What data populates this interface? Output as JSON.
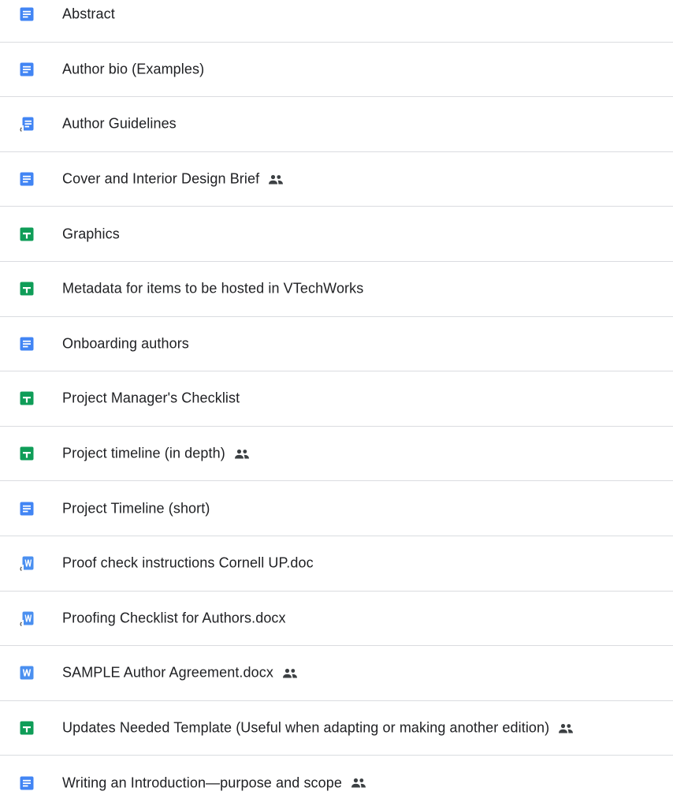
{
  "colors": {
    "docs_blue": "#4285f4",
    "sheets_green": "#0f9d58",
    "word_blue": "#4a8ff0",
    "shared_icon": "#3c4043",
    "divider": "#dadce0"
  },
  "files": [
    {
      "name": "Abstract",
      "icon": "google-docs-icon",
      "shared": false
    },
    {
      "name": "Author bio (Examples)",
      "icon": "google-docs-icon",
      "shared": false
    },
    {
      "name": "Author Guidelines",
      "icon": "google-docs-shortcut-icon",
      "shared": false
    },
    {
      "name": "Cover and Interior Design Brief",
      "icon": "google-docs-icon",
      "shared": true
    },
    {
      "name": "Graphics",
      "icon": "google-sheets-icon",
      "shared": false
    },
    {
      "name": "Metadata for items to be hosted in VTechWorks",
      "icon": "google-sheets-icon",
      "shared": false
    },
    {
      "name": "Onboarding authors",
      "icon": "google-docs-icon",
      "shared": false
    },
    {
      "name": "Project Manager's Checklist",
      "icon": "google-sheets-icon",
      "shared": false
    },
    {
      "name": "Project timeline (in depth)",
      "icon": "google-sheets-icon",
      "shared": true
    },
    {
      "name": "Project Timeline (short)",
      "icon": "google-docs-icon",
      "shared": false
    },
    {
      "name": "Proof check instructions Cornell UP.doc",
      "icon": "word-shortcut-icon",
      "shared": false
    },
    {
      "name": "Proofing Checklist for Authors.docx",
      "icon": "word-shortcut-icon",
      "shared": false
    },
    {
      "name": "SAMPLE Author Agreement.docx",
      "icon": "word-icon",
      "shared": true
    },
    {
      "name": "Updates Needed Template (Useful when adapting or making another edition)",
      "icon": "google-sheets-icon",
      "shared": true
    },
    {
      "name": "Writing an Introduction—purpose and scope",
      "icon": "google-docs-icon",
      "shared": true
    }
  ]
}
